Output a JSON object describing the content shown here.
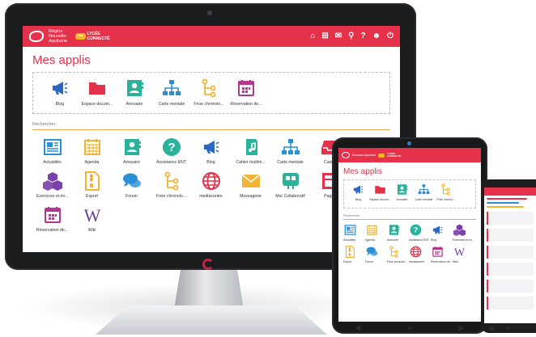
{
  "desktop": {
    "brand": {
      "line1": "Région",
      "line2": "Nouvelle-",
      "line3": "Aquitaine",
      "badge_dots": "•••",
      "badge_l1": "LYCÉE",
      "badge_l2": "CONNECTÉ"
    },
    "top_icons": [
      "home-icon",
      "apps-grid-icon",
      "mail-icon",
      "search-icon",
      "help-icon",
      "avatar-icon",
      "power-icon"
    ],
    "page_title": "Mes applis",
    "favorites": [
      {
        "label": "Blog",
        "icon": "megaphone-icon",
        "color": "#2b66c3"
      },
      {
        "label": "Espace docum...",
        "icon": "folder-icon",
        "color": "#e6314a"
      },
      {
        "label": "Annuaire",
        "icon": "contact-card-icon",
        "color": "#2ab39a"
      },
      {
        "label": "Carte mentale",
        "icon": "sitemap-icon",
        "color": "#2b8fd6"
      },
      {
        "label": "Frise chronolo...",
        "icon": "timeline-icon",
        "color": "#f2b435"
      },
      {
        "label": "Réservation de...",
        "icon": "calendar-icon",
        "color": "#b3368f"
      }
    ],
    "search_label": "Rechercher",
    "apps": [
      {
        "label": "Actualités",
        "icon": "newspaper-icon",
        "color": "#2b8fd6"
      },
      {
        "label": "Agenda",
        "icon": "calendar-grid-icon",
        "color": "#f2b435"
      },
      {
        "label": "Annuaire",
        "icon": "contact-card-icon",
        "color": "#2ab39a"
      },
      {
        "label": "Assistance ENT",
        "icon": "help-icon",
        "color": "#2ab39a"
      },
      {
        "label": "Blog",
        "icon": "megaphone-icon",
        "color": "#2b66c3"
      },
      {
        "label": "Cahier multim...",
        "icon": "music-book-icon",
        "color": "#2ab39a"
      },
      {
        "label": "Carte mentale",
        "icon": "sitemap-icon",
        "color": "#2b8fd6"
      },
      {
        "label": "Casier",
        "icon": "inbox-icon",
        "color": "#e6314a"
      },
      {
        "label": "Exercices et év...",
        "icon": "cubes-icon",
        "color": "#7a3fa8"
      },
      {
        "label": "Export",
        "icon": "file-zip-icon",
        "color": "#f2b435"
      },
      {
        "label": "Forum",
        "icon": "chat-bubbles-icon",
        "color": "#2b8fd6"
      },
      {
        "label": "Frise chronolo...",
        "icon": "timeline-icon",
        "color": "#f2b435"
      },
      {
        "label": "mediacentre",
        "icon": "globe-icon",
        "color": "#e6314a"
      },
      {
        "label": "Messagerie",
        "icon": "envelope-icon",
        "color": "#f2b435"
      },
      {
        "label": "Mur Collaboratif",
        "icon": "board-icon",
        "color": "#2ab39a"
      },
      {
        "label": "Pages",
        "icon": "page-layout-icon",
        "color": "#e6314a"
      },
      {
        "label": "Réservation de...",
        "icon": "calendar-icon",
        "color": "#b3368f"
      },
      {
        "label": "Wiki",
        "icon": "wiki-icon",
        "color": "#6b3fa0"
      }
    ]
  },
  "tablet": {
    "brand": {
      "line1": "Nouvelle-Aquitaine",
      "badge_l1": "LYCÉE",
      "badge_l2": "CONNECTÉ"
    },
    "page_title": "Mes applis",
    "favorites": [
      {
        "label": "Blog",
        "icon": "megaphone-icon",
        "color": "#2b66c3"
      },
      {
        "label": "Espace docum...",
        "icon": "folder-icon",
        "color": "#e6314a"
      },
      {
        "label": "Annuaire",
        "icon": "contact-card-icon",
        "color": "#2ab39a"
      },
      {
        "label": "Carte mentale",
        "icon": "sitemap-icon",
        "color": "#2b8fd6"
      },
      {
        "label": "Frise chrono...",
        "icon": "timeline-icon",
        "color": "#f2b435"
      }
    ],
    "search_label": "Rechercher",
    "apps": [
      {
        "label": "Actualités",
        "icon": "newspaper-icon",
        "color": "#2b8fd6"
      },
      {
        "label": "Agenda",
        "icon": "calendar-grid-icon",
        "color": "#f2b435"
      },
      {
        "label": "Annuaire",
        "icon": "contact-card-icon",
        "color": "#2ab39a"
      },
      {
        "label": "Assistance ENT",
        "icon": "help-icon",
        "color": "#2ab39a"
      },
      {
        "label": "Blog",
        "icon": "megaphone-icon",
        "color": "#2b66c3"
      },
      {
        "label": "Exercices et év...",
        "icon": "cubes-icon",
        "color": "#7a3fa8"
      },
      {
        "label": "Export",
        "icon": "file-zip-icon",
        "color": "#f2b435"
      },
      {
        "label": "Forum",
        "icon": "chat-bubbles-icon",
        "color": "#2b8fd6"
      },
      {
        "label": "Frise chronolo...",
        "icon": "timeline-icon",
        "color": "#f2b435"
      },
      {
        "label": "mediacentre",
        "icon": "globe-icon",
        "color": "#e6314a"
      },
      {
        "label": "Réservation de...",
        "icon": "calendar-icon",
        "color": "#b3368f"
      },
      {
        "label": "Wiki",
        "icon": "wiki-icon",
        "color": "#6b3fa0"
      }
    ],
    "nav_icons": [
      "back-icon",
      "home-circle-icon",
      "recent-apps-icon"
    ]
  },
  "phone": {
    "accent": "#e6314a",
    "nav_icons": [
      "back-icon",
      "home-circle-icon"
    ]
  }
}
